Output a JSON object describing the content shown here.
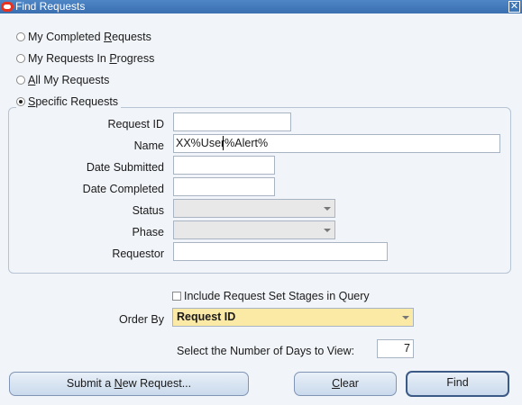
{
  "window": {
    "title": "Find Requests",
    "close_glyph": "✕"
  },
  "options": {
    "completed": {
      "pre": "My Completed ",
      "mn": "R",
      "post": "equests",
      "selected": false
    },
    "in_progress": {
      "pre": "My Requests In ",
      "mn": "P",
      "post": "rogress",
      "selected": false
    },
    "all": {
      "pre": "",
      "mn": "A",
      "post": "ll My Requests",
      "selected": false
    },
    "specific": {
      "pre": "",
      "mn": "S",
      "post": "pecific Requests",
      "selected": true
    }
  },
  "form": {
    "request_id": {
      "label": "Request ID",
      "value": ""
    },
    "name": {
      "label": "Name",
      "value": "XX%User%Alert%"
    },
    "date_submitted": {
      "label": "Date Submitted",
      "value": ""
    },
    "date_completed": {
      "label": "Date Completed",
      "value": ""
    },
    "status": {
      "label": "Status",
      "value": ""
    },
    "phase": {
      "label": "Phase",
      "value": ""
    },
    "requestor": {
      "label": "Requestor",
      "value": ""
    }
  },
  "include_stages": {
    "label": "Include Request Set Stages in Query",
    "checked": false
  },
  "order_by": {
    "label": "Order By",
    "value": "Request ID"
  },
  "days": {
    "label": "Select the Number of Days to View:",
    "value": "7"
  },
  "buttons": {
    "submit": {
      "pre": "Submit a ",
      "mn": "N",
      "post": "ew Request..."
    },
    "clear": {
      "pre": "",
      "mn": "C",
      "post": "lear"
    },
    "find": {
      "pre": "",
      "mn": "",
      "post": "Find"
    }
  },
  "icons": {
    "logo": "oracle-logo",
    "close": "close-icon",
    "dropdown": "chevron-down-icon"
  }
}
